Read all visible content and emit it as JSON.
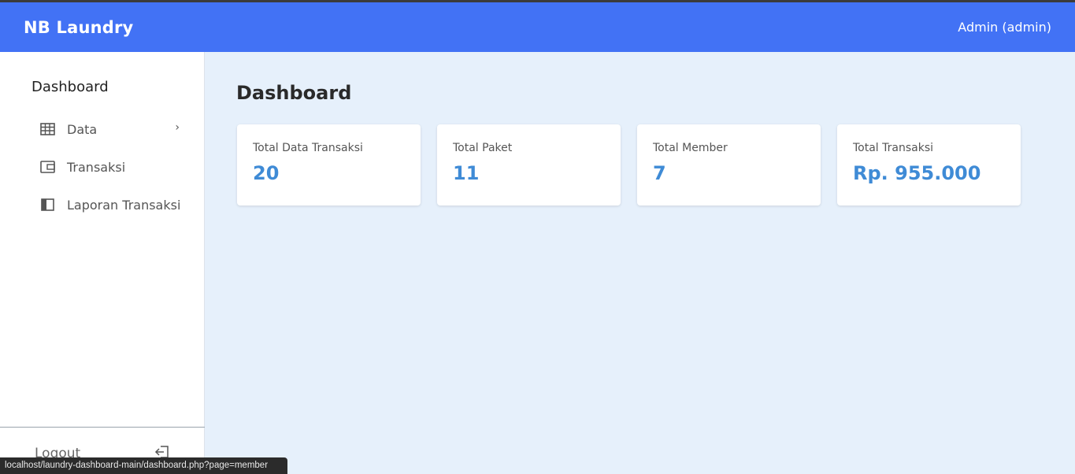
{
  "navbar": {
    "brand": "NB Laundry",
    "user": "Admin (admin)",
    "color": "#4272f5"
  },
  "sidebar": {
    "title": "Dashboard",
    "items": [
      {
        "label": "Data",
        "icon": "table-icon",
        "has_submenu": true
      },
      {
        "label": "Transaksi",
        "icon": "wallet-icon"
      },
      {
        "label": "Laporan Transaksi",
        "icon": "report-icon"
      }
    ],
    "logout_label": "Logout"
  },
  "main": {
    "title": "Dashboard",
    "cards": [
      {
        "label": "Total Data Transaksi",
        "value": "20"
      },
      {
        "label": "Total Paket",
        "value": "11"
      },
      {
        "label": "Total Member",
        "value": "7"
      },
      {
        "label": "Total Transaksi",
        "value": "Rp. 955.000"
      }
    ],
    "accent": "#3f8bd6"
  },
  "statusbar": {
    "url": "localhost/laundry-dashboard-main/dashboard.php?page=member"
  }
}
